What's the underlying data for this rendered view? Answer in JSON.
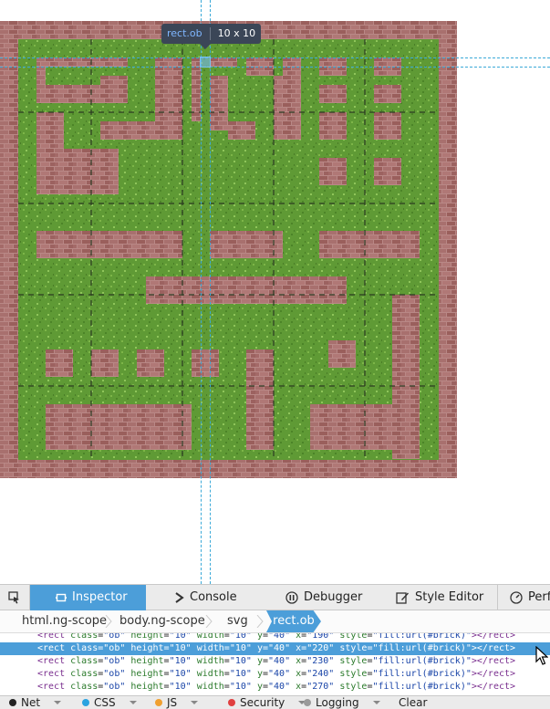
{
  "highlighter": {
    "tag": "rect",
    "class": ".ob",
    "dims": "10 x 10"
  },
  "devtools": {
    "tabs": [
      {
        "label": "Inspector",
        "active": true
      },
      {
        "label": "Console"
      },
      {
        "label": "Debugger"
      },
      {
        "label": "Style Editor"
      },
      {
        "label": "Perf"
      }
    ],
    "breadcrumbs": [
      "html.ng-scope",
      "body.ng-scope",
      "svg",
      "rect.ob"
    ],
    "markup_lines": [
      {
        "tag": "<rect",
        "class": "\"ob\"",
        "height": "\"10\"",
        "width": "\"10\"",
        "y": "\"40\"",
        "x": "\"190\"",
        "style": "\"fill:url(#brick)\"",
        "close": "></rect>"
      },
      {
        "tag": "<rect",
        "class": "\"ob\"",
        "height": "\"10\"",
        "width": "\"10\"",
        "y": "\"40\"",
        "x": "\"220\"",
        "style": "\"fill:url(#brick)\"",
        "close": "></rect>",
        "selected": true
      },
      {
        "tag": "<rect",
        "class": "\"ob\"",
        "height": "\"10\"",
        "width": "\"10\"",
        "y": "\"40\"",
        "x": "\"230\"",
        "style": "\"fill:url(#brick)\"",
        "close": "></rect>"
      },
      {
        "tag": "<rect",
        "class": "\"ob\"",
        "height": "\"10\"",
        "width": "\"10\"",
        "y": "\"40\"",
        "x": "\"240\"",
        "style": "\"fill:url(#brick)\"",
        "close": "></rect>"
      },
      {
        "tag": "<rect",
        "class": "\"ob\"",
        "height": "\"10\"",
        "width": "\"10\"",
        "y": "\"40\"",
        "x": "\"270\"",
        "style": "\"fill:url(#brick)\"",
        "close": "></rect>"
      }
    ],
    "filters": [
      {
        "label": "Net",
        "color": "#222222"
      },
      {
        "label": "CSS",
        "color": "#2aa3e0"
      },
      {
        "label": "JS",
        "color": "#f0a030"
      },
      {
        "label": "Security",
        "color": "#e04040"
      },
      {
        "label": "Logging",
        "color": "#9a9a9a"
      }
    ],
    "clear_label": "Clear"
  },
  "colors": {
    "grass": "#5f9a35",
    "brick": "#a8706e",
    "accent": "#4c9ed9"
  }
}
